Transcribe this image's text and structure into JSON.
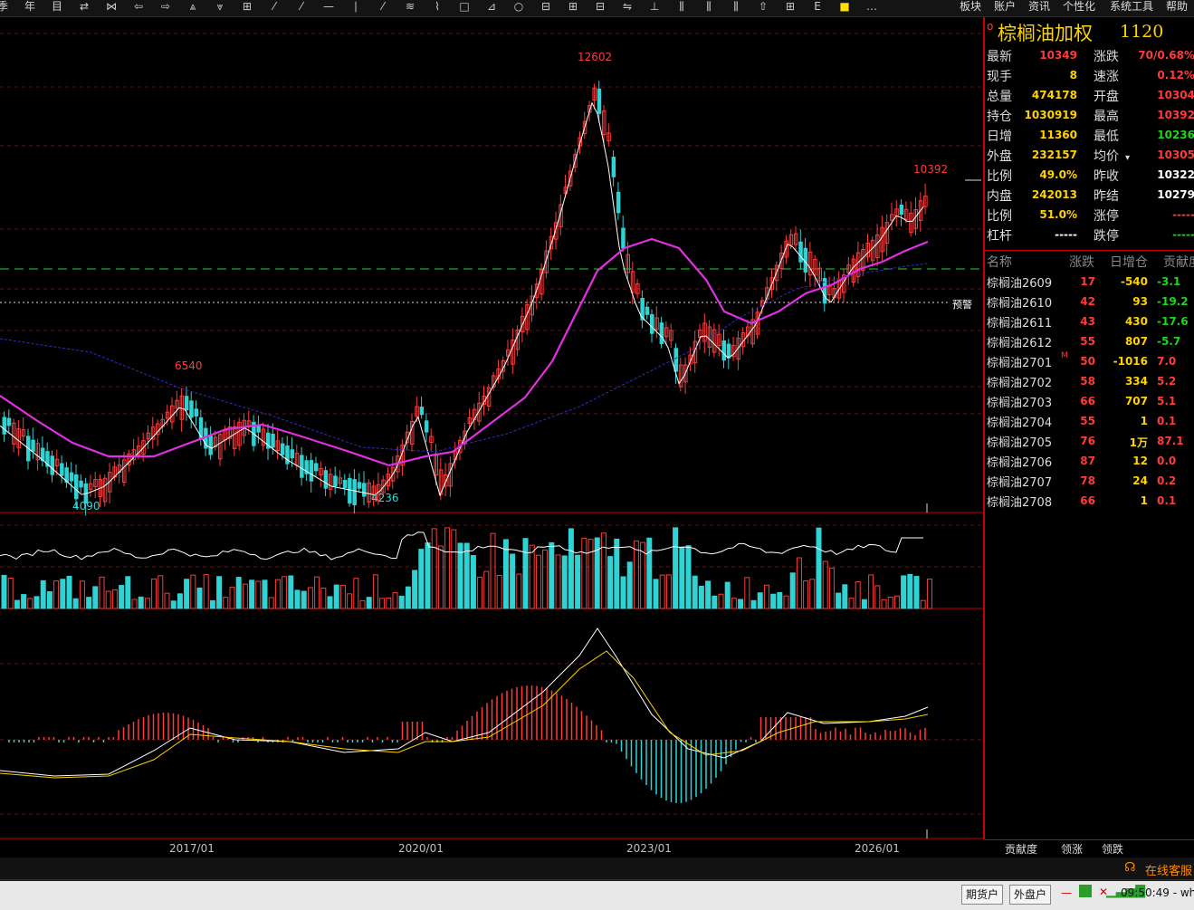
{
  "toolbar": {
    "icons": [
      "季",
      "年",
      "目",
      "⇄",
      "⋈",
      "⇦",
      "⇨",
      "⩓",
      "⩔",
      "⊞",
      "⁄",
      "⁄",
      "—",
      "∣",
      "⁄",
      "≋",
      "⌇",
      "□",
      "⊿",
      "○",
      "⊟",
      "⊞",
      "⊟",
      "⇋",
      "⊥",
      "⫼",
      "⫼",
      "⫼",
      "⇧",
      "⊞",
      "E",
      "■",
      "…"
    ],
    "menu": [
      "板块",
      "账户",
      "资讯",
      "个性化",
      "系统工具",
      "帮助"
    ]
  },
  "chart": {
    "annotations": {
      "high_label": "12602",
      "high2_label": "10392",
      "mid_label": "6540",
      "low_label": "4090",
      "low2_label": "4236",
      "alert_label": "预警"
    },
    "x_labels": [
      "2017/01",
      "2020/01",
      "2023/01",
      "2026/01"
    ]
  },
  "quote": {
    "title": "棕榈油加权",
    "code": "1120",
    "rows": [
      {
        "l1": "最新",
        "v1": "10349",
        "c1": "red",
        "l2": "涨跌",
        "v2": "70/0.68%",
        "c2": "red"
      },
      {
        "l1": "现手",
        "v1": "8",
        "c1": "yellow",
        "l2": "速涨",
        "v2": "0.12%",
        "c2": "red"
      },
      {
        "l1": "总量",
        "v1": "474178",
        "c1": "yellow",
        "l2": "开盘",
        "v2": "10304",
        "c2": "red"
      },
      {
        "l1": "持仓",
        "v1": "1030919",
        "c1": "yellow",
        "l2": "最高",
        "v2": "10392",
        "c2": "red"
      },
      {
        "l1": "日增",
        "v1": "11360",
        "c1": "yellow",
        "l2": "最低",
        "v2": "10236",
        "c2": "green"
      },
      {
        "l1": "外盘",
        "v1": "232157",
        "c1": "yellow",
        "l2": "均价",
        "v2": "10305",
        "c2": "red"
      },
      {
        "l1": "比例",
        "v1": "49.0%",
        "c1": "yellow",
        "l2": "昨收",
        "v2": "10322",
        "c2": "white"
      },
      {
        "l1": "内盘",
        "v1": "242013",
        "c1": "yellow",
        "l2": "昨结",
        "v2": "10279",
        "c2": "white"
      },
      {
        "l1": "比例",
        "v1": "51.0%",
        "c1": "yellow",
        "l2": "涨停",
        "v2": "-----",
        "c2": "red"
      },
      {
        "l1": "杠杆",
        "v1": "-----",
        "c1": "white",
        "l2": "跌停",
        "v2": "-----",
        "c2": "green"
      }
    ],
    "list_header": {
      "name": "名称",
      "change": "涨跌",
      "oi_change": "日增仓",
      "contrib": "贡献度"
    },
    "contracts": [
      {
        "name": "棕榈油2609",
        "change": "17",
        "oi": "-540",
        "contrib": "-3.1",
        "cc": "green"
      },
      {
        "name": "棕榈油2610",
        "change": "42",
        "oi": "93",
        "contrib": "-19.2",
        "cc": "green"
      },
      {
        "name": "棕榈油2611",
        "change": "43",
        "oi": "430",
        "contrib": "-17.6",
        "cc": "green"
      },
      {
        "name": "棕榈油2612",
        "change": "55",
        "oi": "807",
        "contrib": "-5.7",
        "cc": "green"
      },
      {
        "name": "棕榈油2701",
        "change": "50",
        "oi": "-1016",
        "contrib": "7.0",
        "cc": "red",
        "mark": "M"
      },
      {
        "name": "棕榈油2702",
        "change": "58",
        "oi": "334",
        "contrib": "5.2",
        "cc": "red"
      },
      {
        "name": "棕榈油2703",
        "change": "66",
        "oi": "707",
        "contrib": "5.1",
        "cc": "red"
      },
      {
        "name": "棕榈油2704",
        "change": "55",
        "oi": "1",
        "contrib": "0.1",
        "cc": "red"
      },
      {
        "name": "棕榈油2705",
        "change": "76",
        "oi": "1万",
        "contrib": "87.1",
        "cc": "red"
      },
      {
        "name": "棕榈油2706",
        "change": "87",
        "oi": "12",
        "contrib": "0.0",
        "cc": "red"
      },
      {
        "name": "棕榈油2707",
        "change": "78",
        "oi": "24",
        "contrib": "0.2",
        "cc": "red"
      },
      {
        "name": "棕榈油2708",
        "change": "66",
        "oi": "1",
        "contrib": "0.1",
        "cc": "red"
      }
    ],
    "tabs": [
      "贡献度",
      "领涨",
      "领跌"
    ]
  },
  "status": {
    "service": "在线客服",
    "btn1": "期货户",
    "btn2": "外盘户",
    "time": "09:50:49 - wh"
  },
  "colors": {
    "up": "#ff3b3b",
    "down": "#2fd3d3",
    "ma_fast": "#ffffff",
    "ma_slow": "#e030e0",
    "ma_long": "#2030c0"
  }
}
